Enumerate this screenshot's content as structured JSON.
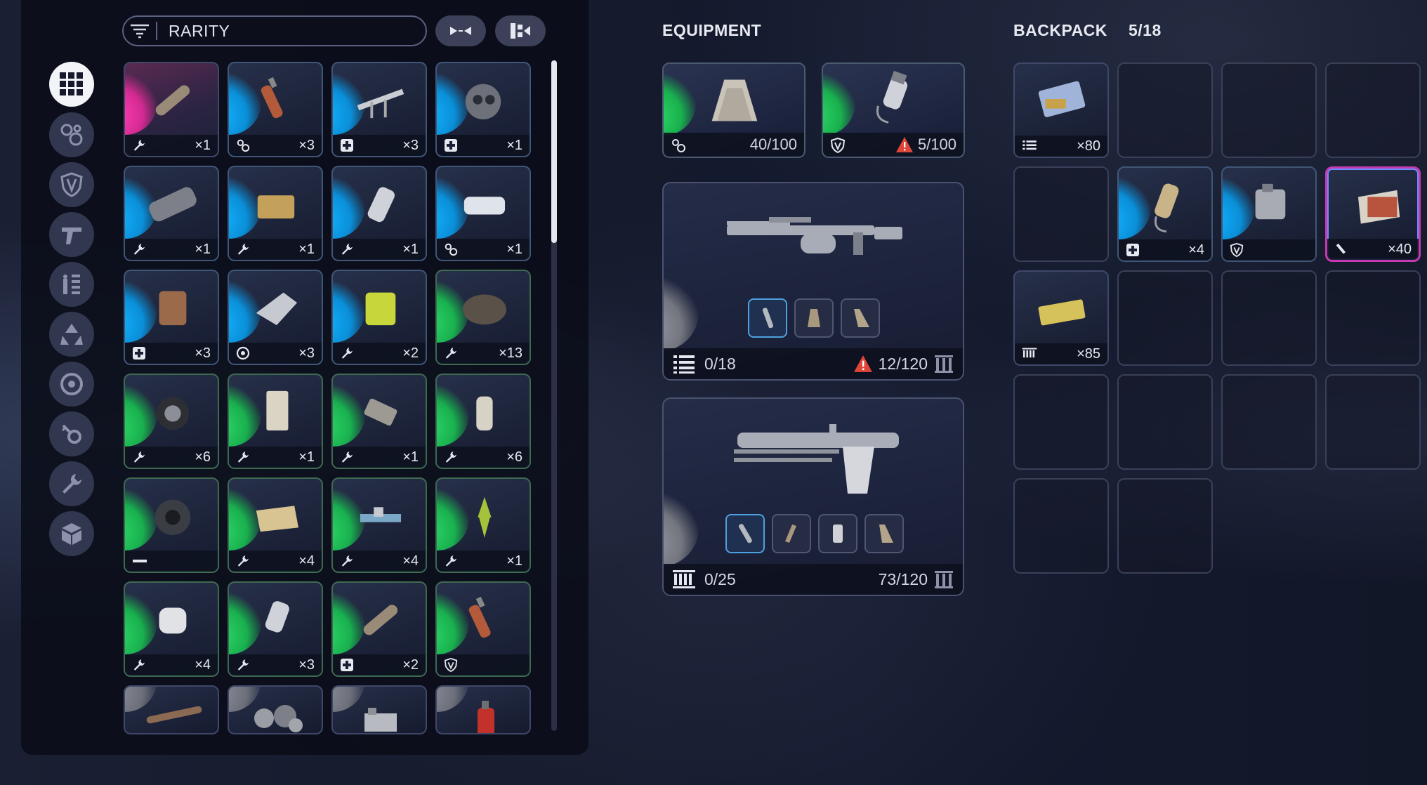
{
  "filter": {
    "label": "RARITY"
  },
  "categories": [
    {
      "icon": "grid-icon",
      "active": true
    },
    {
      "icon": "materials-icon"
    },
    {
      "icon": "shield-icon"
    },
    {
      "icon": "weapon-icon"
    },
    {
      "icon": "ammo-icon"
    },
    {
      "icon": "recycle-icon"
    },
    {
      "icon": "augment-icon"
    },
    {
      "icon": "key-icon"
    },
    {
      "icon": "wrench-icon"
    },
    {
      "icon": "box-icon"
    }
  ],
  "inventory": {
    "rows": [
      [
        {
          "rarity": "pink",
          "type": "wrench-icon",
          "count": "×1"
        },
        {
          "rarity": "blue",
          "type": "materials-icon",
          "count": "×3"
        },
        {
          "rarity": "blue",
          "type": "medical-icon",
          "count": "×3"
        },
        {
          "rarity": "blue",
          "type": "medical-icon",
          "count": "×1"
        }
      ],
      [
        {
          "rarity": "blue",
          "type": "wrench-icon",
          "count": "×1"
        },
        {
          "rarity": "blue",
          "type": "wrench-icon",
          "count": "×1"
        },
        {
          "rarity": "blue",
          "type": "wrench-icon",
          "count": "×1"
        },
        {
          "rarity": "blue",
          "type": "materials-icon",
          "count": "×1"
        }
      ],
      [
        {
          "rarity": "blue",
          "type": "medical-icon",
          "count": "×3"
        },
        {
          "rarity": "blue",
          "type": "target-icon",
          "count": "×3"
        },
        {
          "rarity": "blue",
          "type": "wrench-icon",
          "count": "×2"
        },
        {
          "rarity": "green",
          "type": "wrench-icon",
          "count": "×13"
        }
      ],
      [
        {
          "rarity": "green",
          "type": "wrench-icon",
          "count": "×6"
        },
        {
          "rarity": "green",
          "type": "wrench-icon",
          "count": "×1"
        },
        {
          "rarity": "green",
          "type": "wrench-icon",
          "count": "×1"
        },
        {
          "rarity": "green",
          "type": "wrench-icon",
          "count": "×6"
        }
      ],
      [
        {
          "rarity": "green",
          "type": "dash-icon",
          "count": ""
        },
        {
          "rarity": "green",
          "type": "wrench-icon",
          "count": "×4"
        },
        {
          "rarity": "green",
          "type": "wrench-icon",
          "count": "×4"
        },
        {
          "rarity": "green",
          "type": "wrench-icon",
          "count": "×1"
        }
      ],
      [
        {
          "rarity": "green",
          "type": "wrench-icon",
          "count": "×4"
        },
        {
          "rarity": "green",
          "type": "wrench-icon",
          "count": "×3"
        },
        {
          "rarity": "green",
          "type": "medical-icon",
          "count": "×2"
        },
        {
          "rarity": "green",
          "type": "shield-icon",
          "count": ""
        }
      ]
    ]
  },
  "equipment": {
    "header": "EQUIPMENT",
    "slots": [
      {
        "type": "materials-icon",
        "durability": "40/100",
        "warning": false
      },
      {
        "type": "shield-icon",
        "durability": "5/100",
        "warning": true
      }
    ],
    "weapons": [
      {
        "ammo_icon": "ammo-list-icon",
        "mag": "0/18",
        "reserve": "12/120",
        "warning": true
      },
      {
        "ammo_icon": "ammo-bars-icon",
        "mag": "0/25",
        "reserve": "73/120",
        "warning": false
      }
    ]
  },
  "backpack": {
    "header": "BACKPACK",
    "capacity": "5/18",
    "items": [
      {
        "slot": 0,
        "type": "ammo-list-icon",
        "count": "×80",
        "rarity": "none"
      },
      {
        "slot": 5,
        "type": "medical-icon",
        "count": "×4",
        "rarity": "blue"
      },
      {
        "slot": 6,
        "type": "shield-icon",
        "count": "",
        "rarity": "blue"
      },
      {
        "slot": 7,
        "type": "pen-icon",
        "count": "×40",
        "rarity": "none",
        "selected": true
      },
      {
        "slot": 8,
        "type": "ammo-bars-icon",
        "count": "×85",
        "rarity": "none"
      }
    ]
  }
}
